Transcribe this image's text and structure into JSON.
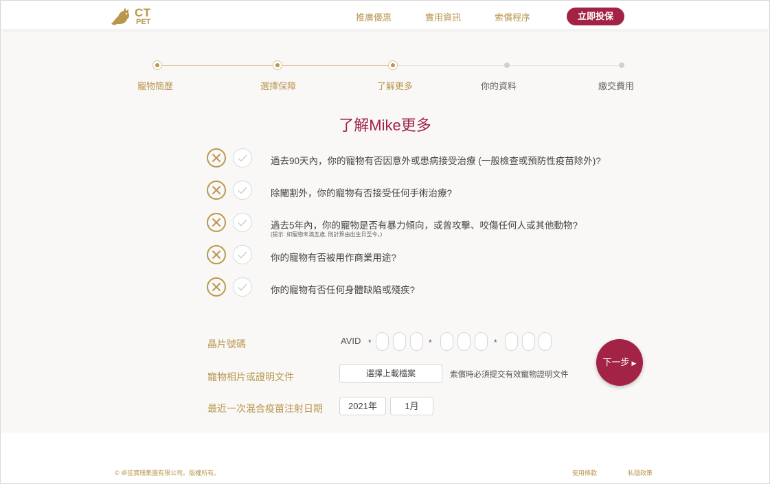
{
  "header": {
    "logo_ct": "CT",
    "logo_pet": "PET",
    "nav": [
      "推廣優惠",
      "實用資訊",
      "索償程序"
    ],
    "cta_label": "立即投保"
  },
  "stepper": {
    "steps": [
      {
        "label": "寵物簡歷",
        "status": "done"
      },
      {
        "label": "選擇保障",
        "status": "done"
      },
      {
        "label": "了解更多",
        "status": "current"
      },
      {
        "label": "你的資料",
        "status": "todo"
      },
      {
        "label": "繳交費用",
        "status": "todo"
      }
    ]
  },
  "title": "了解Mike更多",
  "questions": [
    {
      "text": "過去90天內，你的寵物有否因意外或患病接受治療 (一般檢查或預防性疫苗除外)?",
      "hint": ""
    },
    {
      "text": "除閹割外，你的寵物有否接受任何手術治療?",
      "hint": ""
    },
    {
      "text": "過去5年內，你的寵物是否有暴力傾向，或曾攻擊、咬傷任何人或其他動物?",
      "hint": "(提示: 如寵物未滿五歲, 則計算由出生日至今。)"
    },
    {
      "text": "你的寵物有否被用作商業用途?",
      "hint": ""
    },
    {
      "text": "你的寵物有否任何身體缺陷或殘疾?",
      "hint": ""
    }
  ],
  "form": {
    "chip_label": "晶片號碼",
    "avid_prefix": "AVID",
    "star": "*",
    "photo_label": "寵物相片或證明文件",
    "upload_button": "選擇上載檔案",
    "upload_note": "索償時必須提交有效寵物證明文件",
    "vaccine_label": "最近一次混合疫苗注射日期",
    "year_value": "2021年",
    "month_value": "1月",
    "next_button": "下一步",
    "next_arrow": "▶"
  },
  "footer": {
    "copyright": "© 卓佳寶珊集團有限公司。版權所有。",
    "links": [
      "使用條款",
      "私隱政策"
    ]
  },
  "colors": {
    "gold": "#b9974f",
    "crimson": "#a22345",
    "background": "#f9f8f7"
  }
}
